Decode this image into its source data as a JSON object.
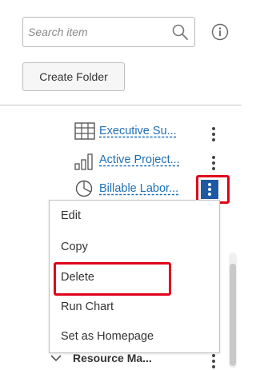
{
  "search": {
    "placeholder": "Search item",
    "value": ""
  },
  "toolbar": {
    "create_folder_label": "Create Folder"
  },
  "items": [
    {
      "label": "Executive Su...",
      "icon": "table-chart-icon"
    },
    {
      "label": "Active Project...",
      "icon": "bar-chart-icon"
    },
    {
      "label": "Billable Labor...",
      "icon": "pie-chart-icon"
    }
  ],
  "context_menu": {
    "items": [
      "Edit",
      "Copy",
      "Delete",
      "Run Chart",
      "Set as Homepage"
    ]
  },
  "folder": {
    "label": "Resource Ma..."
  },
  "colors": {
    "link": "#1f6fb5",
    "active_kebab": "#1e5aa3",
    "highlight": "#e0001b"
  }
}
